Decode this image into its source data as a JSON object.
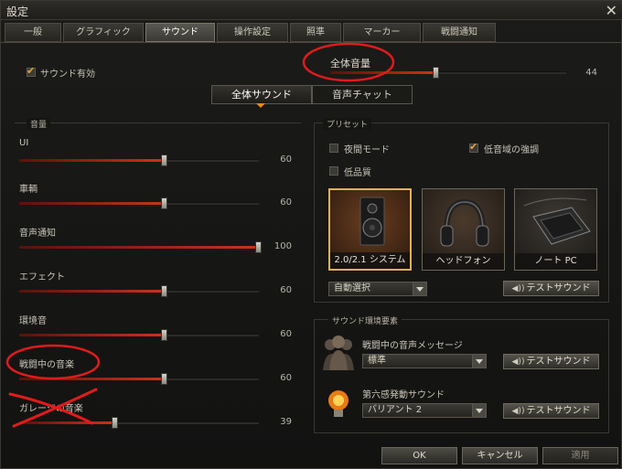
{
  "window": {
    "title": "設定",
    "close_glyph": "✕"
  },
  "tabs": [
    "一般",
    "グラフィック",
    "サウンド",
    "操作設定",
    "照準",
    "マーカー",
    "戦闘通知"
  ],
  "active_tab": "サウンド",
  "sound_enabled": {
    "label": "サウンド有効",
    "checked": true
  },
  "master_volume": {
    "label": "全体音量",
    "value": "44",
    "level_percent": 44
  },
  "sub_tabs": {
    "all": "全体サウンド",
    "voice": "音声チャット"
  },
  "volume_panel": {
    "title": "音量",
    "sliders": [
      {
        "label": "UI",
        "value": "60",
        "level_percent": 60
      },
      {
        "label": "車輌",
        "value": "60",
        "level_percent": 60
      },
      {
        "label": "音声通知",
        "value": "100",
        "level_percent": 100
      },
      {
        "label": "エフェクト",
        "value": "60",
        "level_percent": 60
      },
      {
        "label": "環境音",
        "value": "60",
        "level_percent": 60
      },
      {
        "label": "戦闘中の音楽",
        "value": "60",
        "level_percent": 60
      },
      {
        "label": "ガレージの音楽",
        "value": "39",
        "level_percent": 39
      }
    ]
  },
  "presets": {
    "title": "プリセット",
    "night_mode": {
      "label": "夜間モード",
      "checked": false
    },
    "bass_boost": {
      "label": "低音域の強調",
      "checked": true
    },
    "low_quality": {
      "label": "低品質",
      "checked": false
    },
    "devices": [
      "2.0/2.1 システム",
      "ヘッドフォン",
      "ノート PC"
    ],
    "auto_select": "自動選択",
    "test_sound": "テストサウンド"
  },
  "env_panel": {
    "title": "サウンド環境要素",
    "battle_voice": {
      "label": "戦闘中の音声メッセージ",
      "value": "標準"
    },
    "sixth_sense": {
      "label": "第六感発動サウンド",
      "value": "バリアント 2"
    },
    "test_sound": "テストサウンド"
  },
  "footer": {
    "ok": "OK",
    "cancel": "キャンセル",
    "apply": "適用"
  },
  "annotation_color": "#e01b1b"
}
